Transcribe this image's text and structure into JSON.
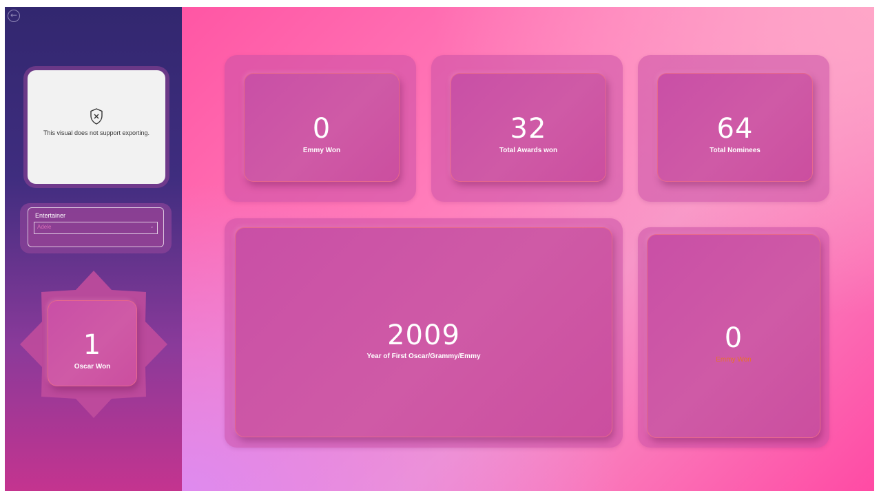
{
  "sidebar": {
    "back_icon": "arrow-left-circle-icon",
    "export_notice": "This visual does not support exporting.",
    "export_icon": "shield-x-icon",
    "slicer": {
      "title": "Entertainer",
      "selected_value": "Adele"
    },
    "oscar_card": {
      "value": "1",
      "label": "Oscar Won"
    }
  },
  "kpis": {
    "emmy_won_top": {
      "value": "0",
      "label": "Emmy Won"
    },
    "total_awards": {
      "value": "32",
      "label": "Total Awards won"
    },
    "total_nominees": {
      "value": "64",
      "label": "Total Nominees"
    },
    "first_year": {
      "value": "2009",
      "label": "Year of First Oscar/Grammy/Emmy"
    },
    "emmy_won_bottom": {
      "value": "0",
      "label": "Emmy Won"
    }
  },
  "colors": {
    "sidebar_top": "#32276f",
    "sidebar_bottom": "#c4348f",
    "main_pink": "#ff56a4",
    "card_fill": "#c94fa6",
    "card_border": "#ff7878",
    "muted_label": "#e8722a"
  }
}
